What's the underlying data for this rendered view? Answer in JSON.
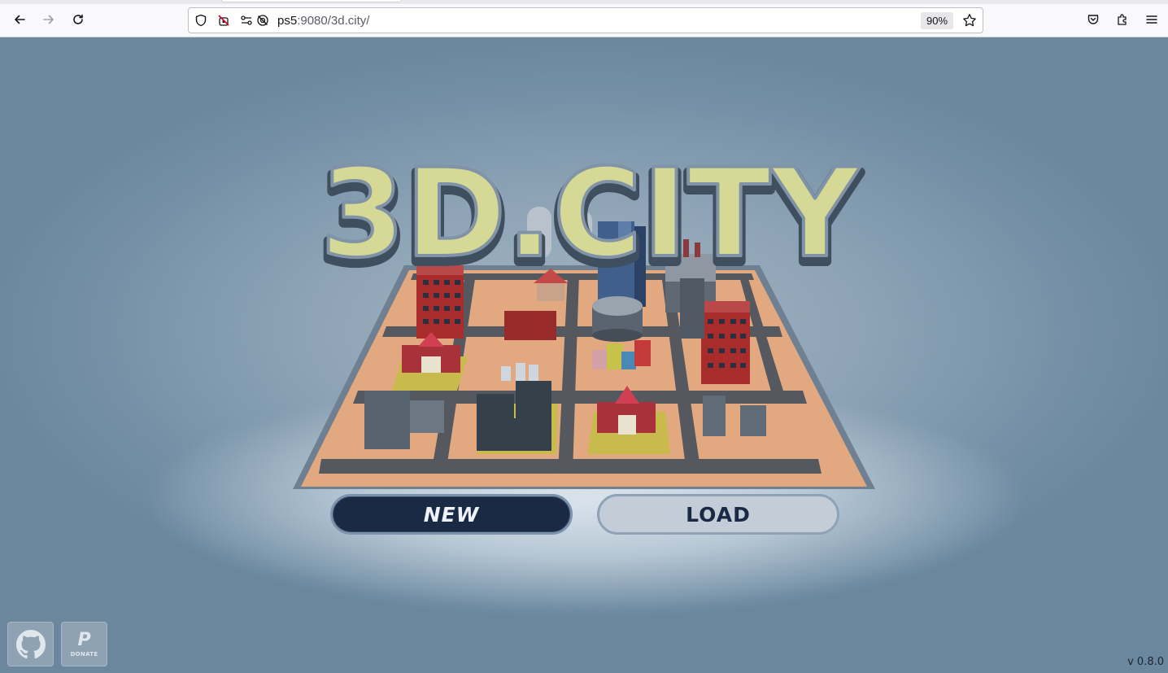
{
  "browser": {
    "url_host": "ps5",
    "url_path": ":9080/3d.city/",
    "zoom": "90%",
    "icons": [
      "back-arrow-icon",
      "forward-arrow-icon",
      "reload-icon",
      "shield-icon",
      "camera-blocked-icon",
      "permissions-icon",
      "tracking-blocked-icon",
      "bookmark-star-icon",
      "pocket-icon",
      "extensions-icon",
      "menu-icon"
    ]
  },
  "game": {
    "logo": "3D.CITY",
    "new_label": "NEW",
    "load_label": "LOAD",
    "donate_label": "DONATE",
    "paypal_glyph": "P",
    "version": "v 0.8.0",
    "colors": {
      "logo_fill": "#d6d895",
      "logo_rim": "#6f8296",
      "board_ground": "#e2a981",
      "road": "#55585f",
      "new_button": "#1b2a44",
      "load_button": "#c4ccd8"
    }
  }
}
